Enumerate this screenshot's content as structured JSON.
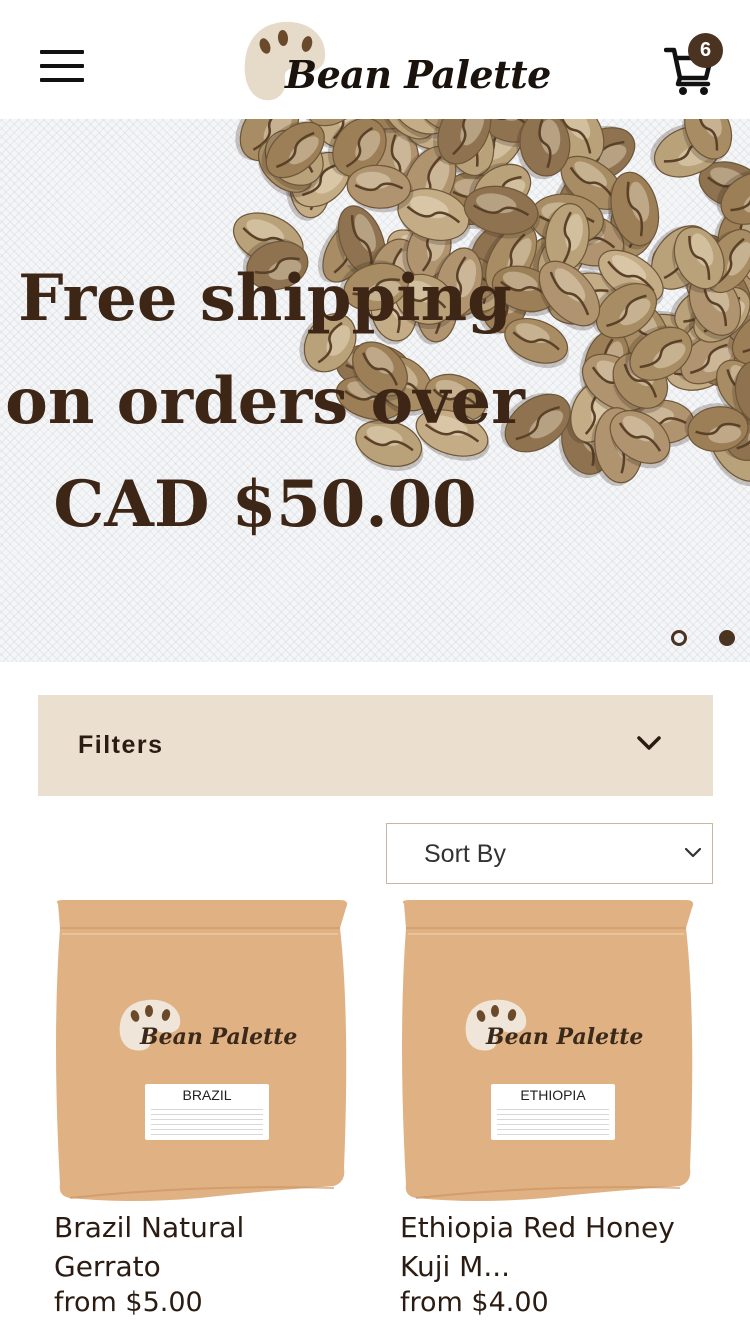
{
  "header": {
    "menu_icon": "hamburger-menu-icon",
    "logo_text": "Bean Palette",
    "cart_icon": "shopping-cart-icon",
    "cart_count": "6"
  },
  "hero": {
    "lines": [
      "Free shipping",
      "on orders over",
      "CAD $50.00"
    ],
    "slide_count": 2,
    "active_slide": 2
  },
  "filters": {
    "label": "Filters",
    "icon": "chevron-down-icon"
  },
  "sort": {
    "label": "Sort By",
    "icon": "chevron-down-icon"
  },
  "products": [
    {
      "bag_brand": "Bean Palette",
      "bag_origin": "BRAZIL",
      "name_line1": "Brazil Natural",
      "name_line2": "Gerrato",
      "price": "from $5.00"
    },
    {
      "bag_brand": "Bean Palette",
      "bag_origin": "ETHIOPIA",
      "name_line1": "Ethiopia Red Honey",
      "name_line2": "Kuji M...",
      "price": "from $4.00"
    }
  ],
  "colors": {
    "brand_brown": "#4b3321",
    "hero_text": "#3d2616",
    "filters_bg": "#ebdfd0",
    "bag_kraft": "#e0b283"
  }
}
